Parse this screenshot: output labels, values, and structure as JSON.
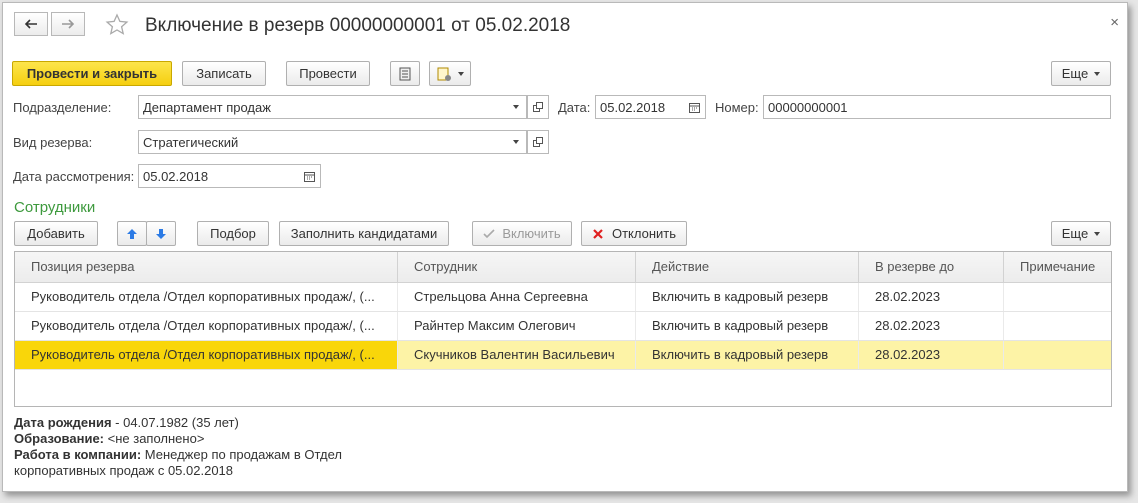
{
  "window": {
    "title": "Включение в резерв 00000000001 от 05.02.2018",
    "close": "×"
  },
  "toolbar": {
    "post_close": "Провести и закрыть",
    "save": "Записать",
    "post": "Провести",
    "more": "Еще"
  },
  "form": {
    "department_label": "Подразделение:",
    "department_value": "Департамент продаж",
    "date_label": "Дата:",
    "date_value": "05.02.2018",
    "number_label": "Номер:",
    "number_value": "00000000001",
    "reserve_type_label": "Вид резерва:",
    "reserve_type_value": "Стратегический",
    "review_date_label": "Дата рассмотрения:",
    "review_date_value": "05.02.2018"
  },
  "employees": {
    "section_title": "Сотрудники",
    "add": "Добавить",
    "pick": "Подбор",
    "fill_candidates": "Заполнить кандидатами",
    "include": "Включить",
    "reject": "Отклонить",
    "more": "Еще"
  },
  "table": {
    "columns": [
      "Позиция резерва",
      "Сотрудник",
      "Действие",
      "В резерве до",
      "Примечание"
    ],
    "rows": [
      {
        "position": "Руководитель отдела /Отдел корпоративных продаж/, (...",
        "employee": "Стрельцова Анна Сергеевна",
        "action": "Включить в кадровый резерв",
        "until": "28.02.2023",
        "note": ""
      },
      {
        "position": "Руководитель отдела /Отдел корпоративных продаж/, (...",
        "employee": "Райнтер Максим Олегович",
        "action": "Включить в кадровый резерв",
        "until": "28.02.2023",
        "note": ""
      },
      {
        "position": "Руководитель отдела /Отдел корпоративных продаж/, (...",
        "employee": "Скучников Валентин Васильевич",
        "action": "Включить в кадровый резерв",
        "until": "28.02.2023",
        "note": ""
      }
    ],
    "selected_row": 2
  },
  "info": {
    "birth_label": "Дата рождения",
    "birth_value": " - 04.07.1982 (35 лет)",
    "education_label": "Образование:",
    "education_value": " <не заполнено>",
    "work_label": "Работа в компании:",
    "work_value_1": " Менеджер по продажам в Отдел",
    "work_value_2": "корпоративных продаж с 05.02.2018"
  },
  "colors": {
    "primary_button": "#f5cf10",
    "section_title": "#3e9a3e",
    "selected_row": "#fdf3a6",
    "selected_cell": "#f9d60a",
    "reject_icon": "#e02020"
  }
}
